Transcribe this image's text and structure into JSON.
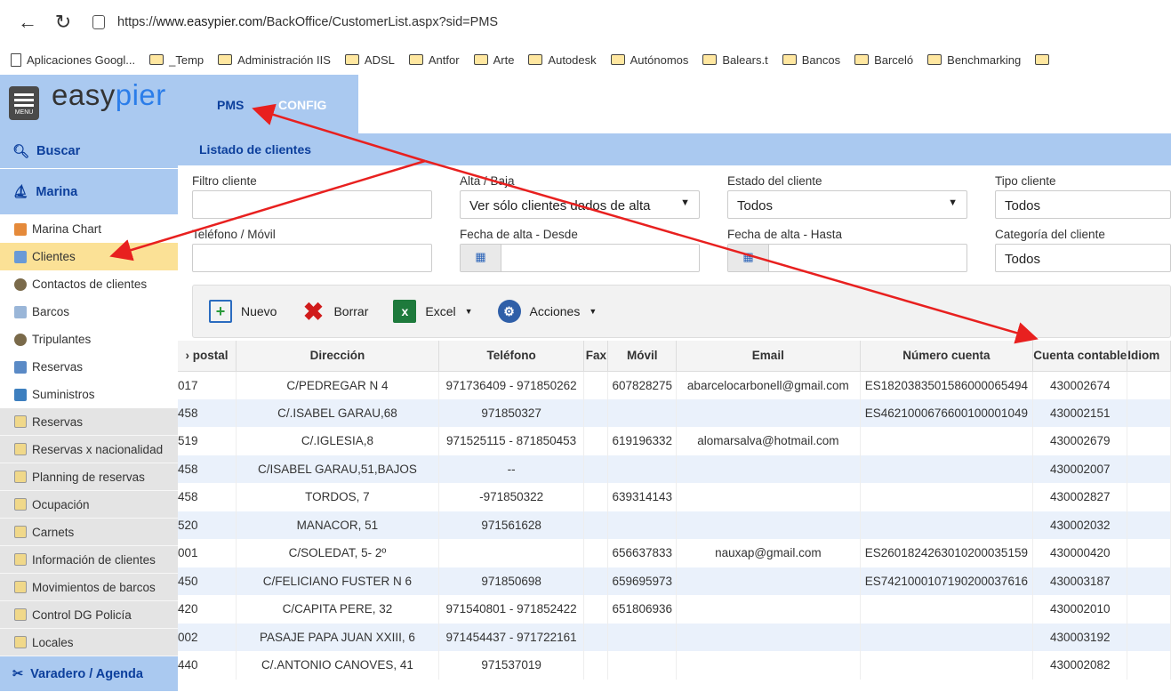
{
  "browser": {
    "url_prefix": "https://",
    "url_host": "www.easypier.com",
    "url_path": "/BackOffice/CustomerList.aspx?sid=PMS"
  },
  "bookmarks": [
    "Aplicaciones Googl...",
    "_Temp",
    "Administración IIS",
    "ADSL",
    "Antfor",
    "Arte",
    "Autodesk",
    "Autónomos",
    "Balears.t",
    "Bancos",
    "Barceló",
    "Benchmarking"
  ],
  "logo": {
    "a": "easy",
    "b": "pier"
  },
  "menu_label": "MENU",
  "tabs": {
    "pms": "PMS",
    "config": "CONFIG"
  },
  "sidebar": {
    "buscar": "Buscar",
    "marina": "Marina",
    "items": [
      "Marina Chart",
      "Clientes",
      "Contactos de clientes",
      "Barcos",
      "Tripulantes",
      "Reservas",
      "Suministros"
    ],
    "reports": [
      "Reservas",
      "Reservas x nacionalidad",
      "Planning de reservas",
      "Ocupación",
      "Carnets",
      "Información de clientes",
      "Movimientos de barcos",
      "Control DG Policía",
      "Locales"
    ],
    "varadero": "Varadero / Agenda"
  },
  "main": {
    "title": "Listado de clientes"
  },
  "filters": {
    "filtro": "Filtro cliente",
    "alta": "Alta / Baja",
    "alta_value": "Ver sólo clientes dados de alta",
    "estado": "Estado del cliente",
    "estado_value": "Todos",
    "tipo": "Tipo cliente",
    "tipo_value": "Todos",
    "telefono": "Teléfono / Móvil",
    "desde": "Fecha de alta - Desde",
    "hasta": "Fecha de alta - Hasta",
    "categoria": "Categoría del cliente",
    "categoria_value": "Todos"
  },
  "toolbar": {
    "nuevo": "Nuevo",
    "borrar": "Borrar",
    "excel": "Excel",
    "acciones": "Acciones"
  },
  "table": {
    "headers": [
      "› postal",
      "Dirección",
      "Teléfono",
      "Fax",
      "Móvil",
      "Email",
      "Número cuenta",
      "Cuenta contable",
      "Idiom"
    ],
    "rows": [
      [
        "017",
        "C/PEDREGAR N 4",
        "971736409 - 971850262",
        "",
        "607828275",
        "abarcelocarbonell@gmail.com",
        "ES1820383501586000065494",
        "430002674",
        ""
      ],
      [
        "458",
        "C/.ISABEL GARAU,68",
        "971850327",
        "",
        "",
        "",
        "ES4621000676600100001049",
        "430002151",
        ""
      ],
      [
        "519",
        "C/.IGLESIA,8",
        "971525115 - 871850453",
        "",
        "619196332",
        "alomarsalva@hotmail.com",
        "",
        "430002679",
        ""
      ],
      [
        "458",
        "C/ISABEL GARAU,51,BAJOS",
        "--",
        "",
        "",
        "",
        "",
        "430002007",
        ""
      ],
      [
        "458",
        "TORDOS, 7",
        "-971850322",
        "",
        "639314143",
        "",
        "",
        "430002827",
        ""
      ],
      [
        "520",
        "MANACOR, 51",
        "971561628",
        "",
        "",
        "",
        "",
        "430002032",
        ""
      ],
      [
        "001",
        "C/SOLEDAT, 5- 2º",
        "",
        "",
        "656637833",
        "nauxap@gmail.com",
        "ES2601824263010200035159",
        "430000420",
        ""
      ],
      [
        "450",
        "C/FELICIANO FUSTER N 6",
        "971850698",
        "",
        "659695973",
        "",
        "ES7421000107190200037616",
        "430003187",
        ""
      ],
      [
        "420",
        "C/CAPITA PERE, 32",
        "971540801 - 971852422",
        "",
        "651806936",
        "",
        "",
        "430002010",
        ""
      ],
      [
        "002",
        "PASAJE PAPA JUAN XXIII, 6",
        "971454437 - 971722161",
        "",
        "",
        "",
        "",
        "430003192",
        ""
      ],
      [
        "440",
        "C/.ANTONIO CANOVES, 41",
        "971537019",
        "",
        "",
        "",
        "",
        "430002082",
        ""
      ]
    ]
  }
}
